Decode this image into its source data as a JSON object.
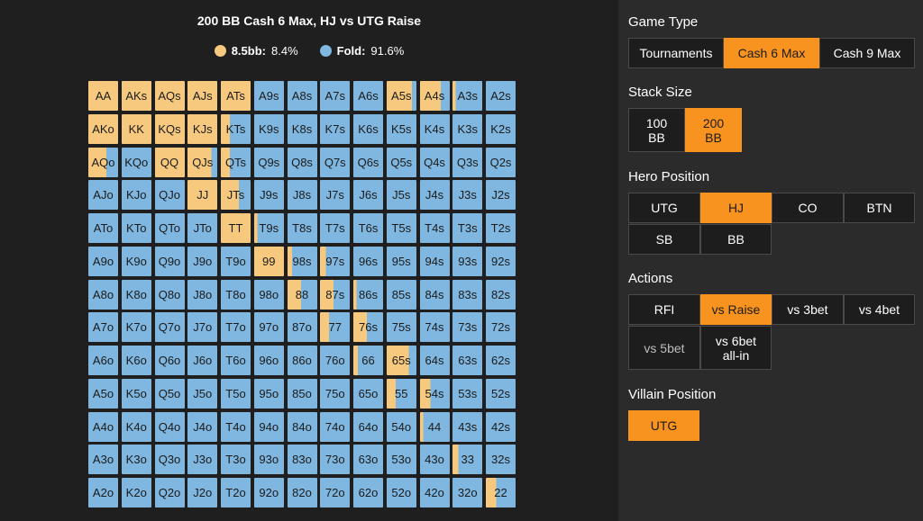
{
  "chart": {
    "title": "200 BB Cash 6 Max, HJ vs UTG Raise",
    "legend": [
      {
        "name": "8.5bb:",
        "value": "8.4%",
        "color": "#f7c97e"
      },
      {
        "name": "Fold:",
        "value": "91.6%",
        "color": "#7fb7e0"
      }
    ]
  },
  "colors": {
    "raise": "#f7c97e",
    "fold": "#7fb7e0",
    "accent": "#f7931e"
  },
  "hands": [
    [
      "AA",
      "AKs",
      "AQs",
      "AJs",
      "ATs",
      "A9s",
      "A8s",
      "A7s",
      "A6s",
      "A5s",
      "A4s",
      "A3s",
      "A2s"
    ],
    [
      "AKo",
      "KK",
      "KQs",
      "KJs",
      "KTs",
      "K9s",
      "K8s",
      "K7s",
      "K6s",
      "K5s",
      "K4s",
      "K3s",
      "K2s"
    ],
    [
      "AQo",
      "KQo",
      "QQ",
      "QJs",
      "QTs",
      "Q9s",
      "Q8s",
      "Q7s",
      "Q6s",
      "Q5s",
      "Q4s",
      "Q3s",
      "Q2s"
    ],
    [
      "AJo",
      "KJo",
      "QJo",
      "JJ",
      "JTs",
      "J9s",
      "J8s",
      "J7s",
      "J6s",
      "J5s",
      "J4s",
      "J3s",
      "J2s"
    ],
    [
      "ATo",
      "KTo",
      "QTo",
      "JTo",
      "TT",
      "T9s",
      "T8s",
      "T7s",
      "T6s",
      "T5s",
      "T4s",
      "T3s",
      "T2s"
    ],
    [
      "A9o",
      "K9o",
      "Q9o",
      "J9o",
      "T9o",
      "99",
      "98s",
      "97s",
      "96s",
      "95s",
      "94s",
      "93s",
      "92s"
    ],
    [
      "A8o",
      "K8o",
      "Q8o",
      "J8o",
      "T8o",
      "98o",
      "88",
      "87s",
      "86s",
      "85s",
      "84s",
      "83s",
      "82s"
    ],
    [
      "A7o",
      "K7o",
      "Q7o",
      "J7o",
      "T7o",
      "97o",
      "87o",
      "77",
      "76s",
      "75s",
      "74s",
      "73s",
      "72s"
    ],
    [
      "A6o",
      "K6o",
      "Q6o",
      "J6o",
      "T6o",
      "96o",
      "86o",
      "76o",
      "66",
      "65s",
      "64s",
      "63s",
      "62s"
    ],
    [
      "A5o",
      "K5o",
      "Q5o",
      "J5o",
      "T5o",
      "95o",
      "85o",
      "75o",
      "65o",
      "55",
      "54s",
      "53s",
      "52s"
    ],
    [
      "A4o",
      "K4o",
      "Q4o",
      "J4o",
      "T4o",
      "94o",
      "84o",
      "74o",
      "64o",
      "54o",
      "44",
      "43s",
      "42s"
    ],
    [
      "A3o",
      "K3o",
      "Q3o",
      "J3o",
      "T3o",
      "93o",
      "83o",
      "73o",
      "63o",
      "53o",
      "43o",
      "33",
      "32s"
    ],
    [
      "A2o",
      "K2o",
      "Q2o",
      "J2o",
      "T2o",
      "92o",
      "82o",
      "72o",
      "62o",
      "52o",
      "42o",
      "32o",
      "22"
    ]
  ],
  "raise_freq": [
    [
      1,
      1,
      1,
      1,
      1,
      0,
      0,
      0,
      0,
      0.85,
      0.7,
      0.1,
      0
    ],
    [
      1,
      1,
      1,
      1,
      0.3,
      0,
      0,
      0,
      0,
      0,
      0,
      0,
      0
    ],
    [
      0.6,
      0,
      1,
      0.8,
      0.3,
      0,
      0,
      0,
      0,
      0,
      0,
      0,
      0
    ],
    [
      0,
      0,
      0,
      1,
      0.6,
      0,
      0,
      0,
      0,
      0,
      0,
      0,
      0
    ],
    [
      0,
      0,
      0,
      0,
      1,
      0.1,
      0,
      0,
      0,
      0,
      0,
      0,
      0
    ],
    [
      0,
      0,
      0,
      0,
      0,
      1,
      0.15,
      0.2,
      0,
      0,
      0,
      0,
      0
    ],
    [
      0,
      0,
      0,
      0,
      0,
      0,
      0.45,
      0.45,
      0.1,
      0,
      0,
      0,
      0
    ],
    [
      0,
      0,
      0,
      0,
      0,
      0,
      0,
      0.3,
      0.45,
      0,
      0,
      0,
      0
    ],
    [
      0,
      0,
      0,
      0,
      0,
      0,
      0,
      0,
      0.15,
      0.75,
      0,
      0,
      0
    ],
    [
      0,
      0,
      0,
      0,
      0,
      0,
      0,
      0,
      0,
      0.3,
      0.35,
      0,
      0
    ],
    [
      0,
      0,
      0,
      0,
      0,
      0,
      0,
      0,
      0,
      0,
      0.1,
      0,
      0
    ],
    [
      0,
      0,
      0,
      0,
      0,
      0,
      0,
      0,
      0,
      0,
      0,
      0.2,
      0
    ],
    [
      0,
      0,
      0,
      0,
      0,
      0,
      0,
      0,
      0,
      0,
      0,
      0,
      0.35
    ]
  ],
  "panel": {
    "game_type": {
      "label": "Game Type",
      "options": [
        "Tournaments",
        "Cash 6 Max",
        "Cash 9 Max"
      ],
      "selected": "Cash 6 Max"
    },
    "stack_size": {
      "label": "Stack Size",
      "options": [
        "100\nBB",
        "200\nBB"
      ],
      "selected": "200\nBB"
    },
    "hero_position": {
      "label": "Hero Position",
      "options": [
        "UTG",
        "HJ",
        "CO",
        "BTN",
        "SB",
        "BB"
      ],
      "selected": "HJ"
    },
    "actions": {
      "label": "Actions",
      "options": [
        "RFI",
        "vs Raise",
        "vs 3bet",
        "vs 4bet",
        "vs 5bet",
        "vs 6bet\nall-in"
      ],
      "selected": "vs Raise"
    },
    "villain_position": {
      "label": "Villain Position",
      "options": [
        "UTG"
      ],
      "selected": "UTG"
    }
  }
}
